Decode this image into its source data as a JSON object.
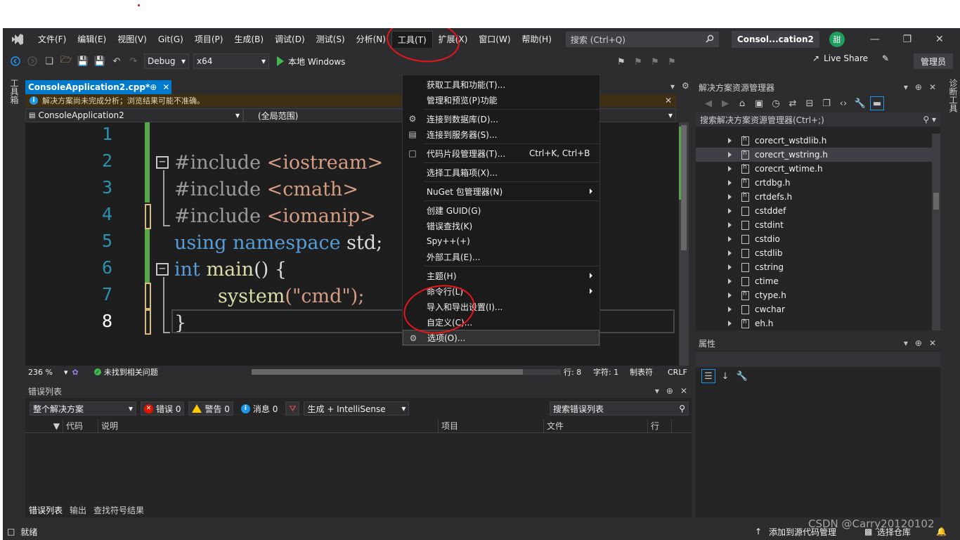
{
  "menubar": {
    "items": [
      "文件(F)",
      "编辑(E)",
      "视图(V)",
      "Git(G)",
      "项目(P)",
      "生成(B)",
      "调试(D)",
      "测试(S)",
      "分析(N)",
      "工具(T)",
      "扩展(X)",
      "窗口(W)",
      "帮助(H)"
    ],
    "search_placeholder": "搜索 (Ctrl+Q)",
    "solution_title": "Consol...cation2",
    "avatar_text": "甜"
  },
  "toolbar": {
    "config": "Debug",
    "platform": "x64",
    "run_label": "本地 Windows",
    "live_share": "Live Share",
    "admin": "管理员"
  },
  "left_strip_label": "工具箱",
  "right_strip_label": "诊断工具",
  "editor": {
    "tab_title": "ConsoleApplication2.cpp*",
    "info_message": "解决方案尚未完成分析；浏览结果可能不准确。",
    "scope_project": "ConsoleApplication2",
    "scope_global": "(全局范围)",
    "lines": [
      {
        "num": "1",
        "pre": "#include ",
        "inc": "<iostream>"
      },
      {
        "num": "2",
        "pre": "#include ",
        "inc": "<cmath>"
      },
      {
        "num": "3",
        "pre": "#include ",
        "inc": "<iomanip>"
      },
      {
        "num": "4",
        "kw1": "using",
        "kw2": "namespace",
        "rest": "std;"
      },
      {
        "num": "5",
        "kw1": "int",
        "fn": "main",
        "rest": "() {"
      },
      {
        "num": "6",
        "fn": "system",
        "str": "(\"cmd\");"
      },
      {
        "num": "7",
        "rest": "}"
      },
      {
        "num": "8"
      }
    ],
    "zoom": "236 %",
    "issues": "未找到相关问题",
    "row": "行: 8",
    "col": "字符: 1",
    "tabs_mode": "制表符",
    "eol": "CRLF"
  },
  "error_list": {
    "title": "错误列表",
    "scope": "整个解决方案",
    "errors": "错误 0",
    "warnings": "警告 0",
    "messages": "消息 0",
    "build_filter": "生成 + IntelliSense",
    "search": "搜索错误列表",
    "columns": [
      "代码",
      "说明",
      "项目",
      "文件",
      "行"
    ],
    "bottom_tabs": [
      "错误列表",
      "输出",
      "查找符号结果"
    ]
  },
  "solution_explorer": {
    "title": "解决方案资源管理器",
    "search": "搜索解决方案资源管理器(Ctrl+;)",
    "files": [
      {
        "name": "corecrt_wstdlib.h",
        "h": true
      },
      {
        "name": "corecrt_wstring.h",
        "h": true,
        "selected": true
      },
      {
        "name": "corecrt_wtime.h",
        "h": true
      },
      {
        "name": "crtdbg.h",
        "h": true
      },
      {
        "name": "crtdefs.h",
        "h": true
      },
      {
        "name": "cstddef",
        "h": false
      },
      {
        "name": "cstdint",
        "h": false
      },
      {
        "name": "cstdio",
        "h": false
      },
      {
        "name": "cstdlib",
        "h": false
      },
      {
        "name": "cstring",
        "h": false
      },
      {
        "name": "ctime",
        "h": false
      },
      {
        "name": "ctype.h",
        "h": true
      },
      {
        "name": "cwchar",
        "h": false
      },
      {
        "name": "eh.h",
        "h": true
      }
    ]
  },
  "properties": {
    "title": "属性"
  },
  "statusbar": {
    "ready": "就绪",
    "source_control": "添加到源代码管理",
    "repo": "选择仓库",
    "watermark": "CSDN @Carry20120102"
  },
  "tools_menu": {
    "items": [
      {
        "label": "获取工具和功能(T)...",
        "icon": ""
      },
      {
        "label": "管理和预览(P)功能",
        "icon": ""
      },
      {
        "sep": true
      },
      {
        "label": "连接到数据库(D)...",
        "icon": "database-connect-icon"
      },
      {
        "label": "连接到服务器(S)...",
        "icon": "server-connect-icon"
      },
      {
        "sep": true
      },
      {
        "label": "代码片段管理器(T)...",
        "icon": "snippet-icon",
        "shortcut": "Ctrl+K, Ctrl+B"
      },
      {
        "sep": true
      },
      {
        "label": "选择工具箱项(X)...",
        "icon": ""
      },
      {
        "sep": true
      },
      {
        "label": "NuGet 包管理器(N)",
        "icon": "",
        "submenu": true
      },
      {
        "sep": true
      },
      {
        "label": "创建 GUID(G)",
        "icon": ""
      },
      {
        "label": "错误查找(K)",
        "icon": ""
      },
      {
        "label": "Spy++(+)",
        "icon": ""
      },
      {
        "label": "外部工具(E)...",
        "icon": ""
      },
      {
        "sep": true
      },
      {
        "label": "主题(H)",
        "icon": "",
        "submenu": true
      },
      {
        "label": "命令行(L)",
        "icon": "",
        "submenu": true
      },
      {
        "label": "导入和导出设置(I)...",
        "icon": ""
      },
      {
        "label": "自定义(C)...",
        "icon": ""
      },
      {
        "label": "选项(O)...",
        "icon": "gear-icon",
        "hover": true
      }
    ]
  },
  "colors": {
    "accent": "#007acc",
    "annotation": "#e8151b"
  }
}
